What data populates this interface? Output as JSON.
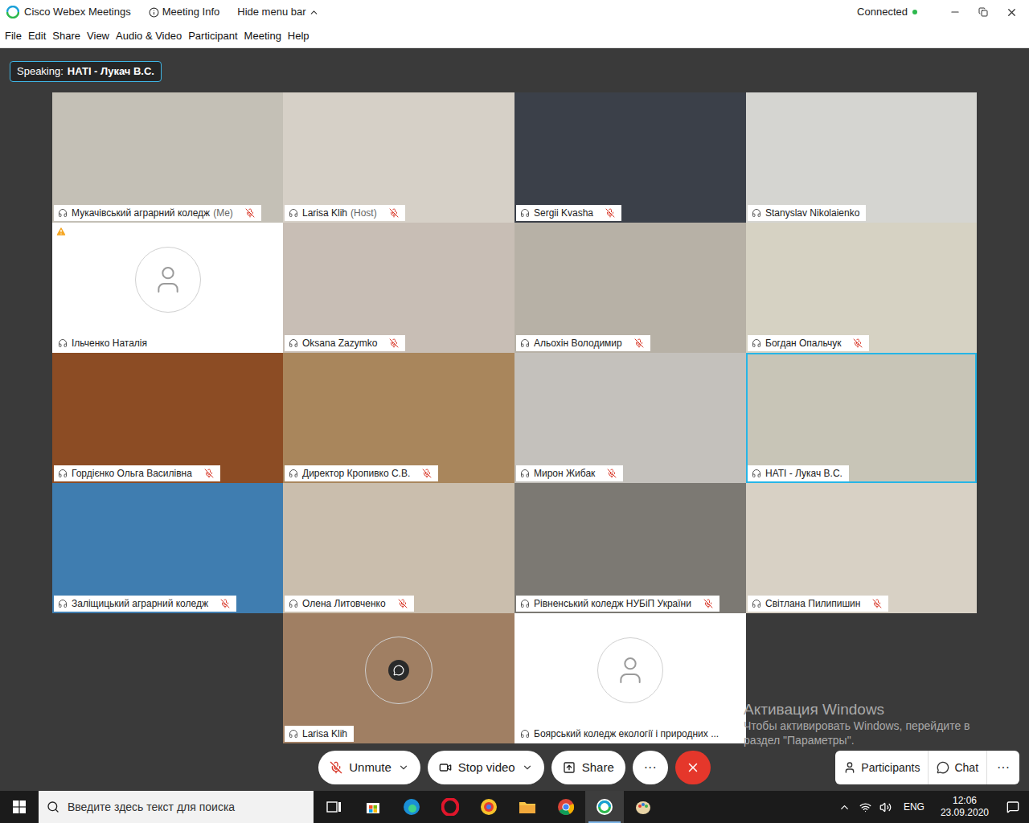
{
  "window": {
    "title": "Cisco Webex Meetings",
    "meeting_info": "Meeting Info",
    "hide_menu": "Hide menu bar",
    "status": "Connected"
  },
  "menu": [
    "File",
    "Edit",
    "Share",
    "View",
    "Audio & Video",
    "Participant",
    "Meeting",
    "Help"
  ],
  "speaking": {
    "label": "Speaking:",
    "name": "НАТІ - Лукач В.С."
  },
  "tiles": [
    {
      "name": "Мукачівський аграрний коледж",
      "suffix": "(Me)",
      "muted": true,
      "kind": "video",
      "color": "#c4c0b6",
      "selected": false,
      "warning": false
    },
    {
      "name": "Larisa Klih",
      "suffix": "(Host)",
      "muted": true,
      "kind": "video",
      "color": "#d6d0c7",
      "selected": false,
      "warning": false
    },
    {
      "name": "Sergii Kvasha",
      "suffix": "",
      "muted": true,
      "kind": "video",
      "color": "#3b4049",
      "selected": false,
      "warning": false
    },
    {
      "name": "Stanyslav Nikolaienko",
      "suffix": "",
      "muted": false,
      "kind": "video",
      "color": "#d5d5d1",
      "selected": false,
      "warning": false
    },
    {
      "name": "Ільченко Наталія",
      "suffix": "",
      "muted": false,
      "kind": "avatar",
      "color": "#ffffff",
      "selected": false,
      "warning": true
    },
    {
      "name": "Oksana Zazymko",
      "suffix": "",
      "muted": true,
      "kind": "video",
      "color": "#c8beb5",
      "selected": false,
      "warning": false
    },
    {
      "name": "Альохін Володимир",
      "suffix": "",
      "muted": true,
      "kind": "video",
      "color": "#b7b1a6",
      "selected": false,
      "warning": false
    },
    {
      "name": "Богдан Опальчук",
      "suffix": "",
      "muted": true,
      "kind": "video",
      "color": "#d6d2c3",
      "selected": false,
      "warning": false
    },
    {
      "name": "Гордієнко Ольга Василівна",
      "suffix": "",
      "muted": true,
      "kind": "video",
      "color": "#8c4c24",
      "selected": false,
      "warning": false
    },
    {
      "name": "Директор Кропивко С.В.",
      "suffix": "",
      "muted": true,
      "kind": "video",
      "color": "#a9865c",
      "selected": false,
      "warning": false
    },
    {
      "name": "Мирон Жибак",
      "suffix": "",
      "muted": true,
      "kind": "video",
      "color": "#c4c1bc",
      "selected": false,
      "warning": false
    },
    {
      "name": "НАТІ - Лукач В.С.",
      "suffix": "",
      "muted": false,
      "kind": "video",
      "color": "#c8c5b7",
      "selected": true,
      "warning": false
    },
    {
      "name": "Заліщицький аграрний коледж",
      "suffix": "",
      "muted": true,
      "kind": "video",
      "color": "#3f7db0",
      "selected": false,
      "warning": false
    },
    {
      "name": "Олена Литовченко",
      "suffix": "",
      "muted": true,
      "kind": "video",
      "color": "#cabead",
      "selected": false,
      "warning": false
    },
    {
      "name": "Рівненський коледж НУБіП України",
      "suffix": "",
      "muted": true,
      "kind": "video",
      "color": "#7c7973",
      "selected": false,
      "warning": false
    },
    {
      "name": "Світлана Пилипишин",
      "suffix": "",
      "muted": true,
      "kind": "video",
      "color": "#d8d1c5",
      "selected": false,
      "warning": false
    },
    {
      "name": "Larisa Klih",
      "suffix": "",
      "muted": false,
      "kind": "photo-avatar",
      "color": "#a07f63",
      "selected": false,
      "warning": false
    },
    {
      "name": "Боярський коледж екології і природних ...",
      "suffix": "",
      "muted": false,
      "kind": "avatar",
      "color": "#ffffff",
      "selected": false,
      "warning": false
    }
  ],
  "toolbar": {
    "unmute": "Unmute",
    "stop_video": "Stop video",
    "share": "Share",
    "more": "···"
  },
  "side_buttons": {
    "participants": "Participants",
    "chat": "Chat",
    "more": "···"
  },
  "watermark": {
    "title": "Активация Windows",
    "line1": "Чтобы активировать Windows, перейдите в",
    "line2": "раздел \"Параметры\"."
  },
  "taskbar": {
    "search_placeholder": "Введите здесь текст для поиска",
    "language": "ENG",
    "time": "12:06",
    "date": "23.09.2020"
  }
}
